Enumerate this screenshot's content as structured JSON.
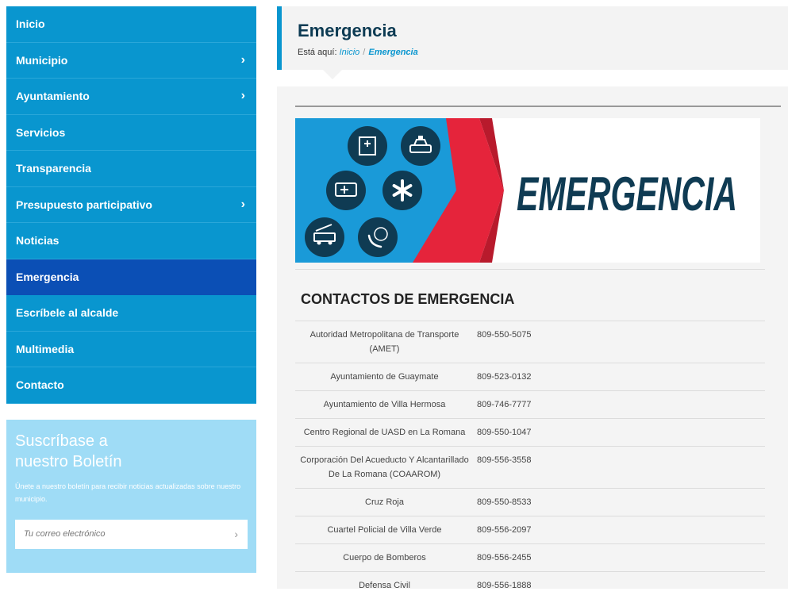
{
  "sidebar": {
    "items": [
      {
        "label": "Inicio",
        "has_submenu": false,
        "active": false
      },
      {
        "label": "Municipio",
        "has_submenu": true,
        "active": false
      },
      {
        "label": "Ayuntamiento",
        "has_submenu": true,
        "active": false
      },
      {
        "label": "Servicios",
        "has_submenu": false,
        "active": false
      },
      {
        "label": "Transparencia",
        "has_submenu": false,
        "active": false
      },
      {
        "label": "Presupuesto participativo",
        "has_submenu": true,
        "active": false
      },
      {
        "label": "Noticias",
        "has_submenu": false,
        "active": false
      },
      {
        "label": "Emergencia",
        "has_submenu": false,
        "active": true
      },
      {
        "label": "Escríbele al alcalde",
        "has_submenu": false,
        "active": false
      },
      {
        "label": "Multimedia",
        "has_submenu": false,
        "active": false
      },
      {
        "label": "Contacto",
        "has_submenu": false,
        "active": false
      }
    ],
    "submenu_icon": "chevron-right-icon"
  },
  "newsletter": {
    "title_line1": "Suscríbase a",
    "title_line2": "nuestro Boletín",
    "description": "Únete a nuestro boletín para recibir noticias actualizadas sobre nuestro municipio.",
    "email_placeholder": "Tu correo electrónico",
    "submit_icon": "chevron-right-icon"
  },
  "header": {
    "title": "Emergencia",
    "breadcrumb_prefix": "Está aquí:",
    "breadcrumb_home": "Inicio",
    "breadcrumb_separator": "/",
    "breadcrumb_current": "Emergencia"
  },
  "banner": {
    "text": "EMERGENCIA",
    "icons": [
      "hospital-icon",
      "police-car-icon",
      "ambulance-icon",
      "medical-star-icon",
      "fire-truck-icon",
      "phone-24h-icon"
    ]
  },
  "contacts": {
    "title": "CONTACTOS DE EMERGENCIA",
    "rows": [
      {
        "name": "Autoridad Metropolitana de Transporte (AMET)",
        "phone": "809-550-5075"
      },
      {
        "name": "Ayuntamiento de Guaymate",
        "phone": "809-523-0132"
      },
      {
        "name": "Ayuntamiento de Villa Hermosa",
        "phone": "809-746-7777"
      },
      {
        "name": "Centro Regional de UASD en La Romana",
        "phone": "809-550-1047"
      },
      {
        "name": "Corporación Del Acueducto Y Alcantarillado De La Romana (COAAROM)",
        "phone": "809-556-3558"
      },
      {
        "name": "Cruz Roja",
        "phone": "809-550-8533"
      },
      {
        "name": "Cuartel Policial de Villa Verde",
        "phone": " 809-556-2097"
      },
      {
        "name": "Cuerpo de Bomberos",
        "phone": " 809-556-2455"
      },
      {
        "name": "Defensa Civil",
        "phone": "809-556-1888"
      }
    ]
  },
  "colors": {
    "nav_bg": "#0996cf",
    "nav_active": "#0b4fb5",
    "newsletter_bg": "#9fdcf6",
    "title_color": "#0d3b53",
    "banner_red": "#e5243b"
  }
}
